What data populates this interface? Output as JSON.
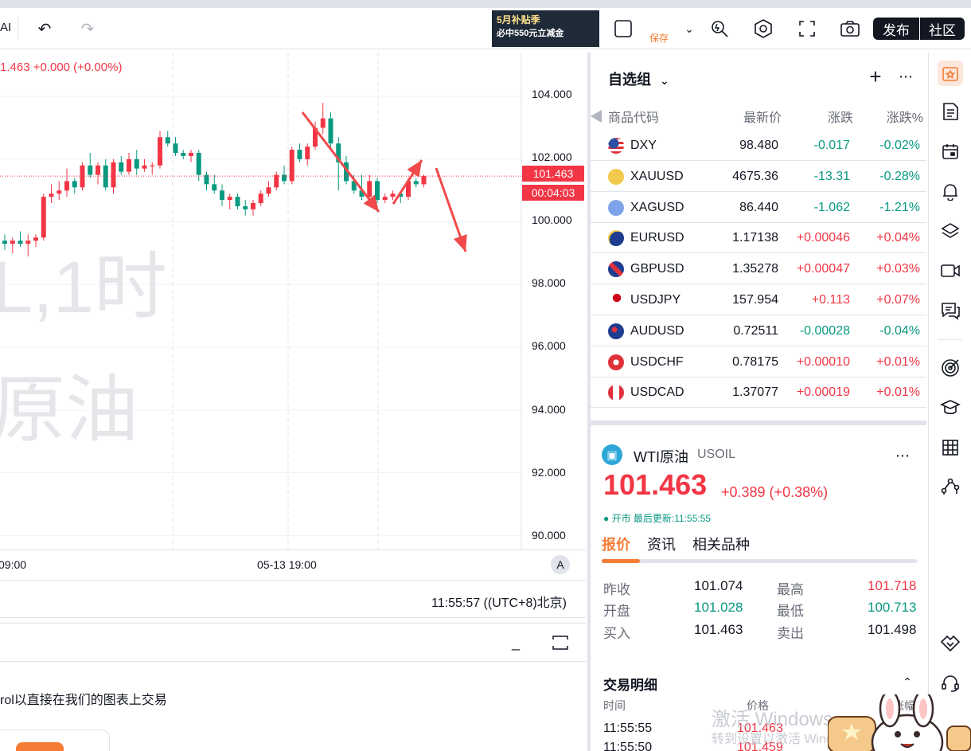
{
  "topbar": {
    "left_label": "AI",
    "promo_line1": "5月补贴季",
    "promo_line2": "必中550元立减金",
    "save_label": "保存",
    "publish_label": "发布",
    "community_label": "社区"
  },
  "chart": {
    "ohlc_info": "1.463  +0.000 (+0.00%)",
    "watermark_line1": "L,1时",
    "watermark_line2": "原油",
    "price_axis": [
      "104.000",
      "102.000",
      "100.000",
      "98.000",
      "96.000",
      "94.000",
      "92.000",
      "90.000"
    ],
    "last_price_tag": "101.463",
    "countdown_tag": "00:04:03",
    "time_labels": [
      "09:00",
      "05-13 19:00"
    ],
    "auto_button": "A",
    "clock": "11:55:57 ((UTC+8)北京)"
  },
  "chart_data": {
    "type": "candlestick",
    "ylim": [
      89.5,
      105.4
    ],
    "candles": [
      {
        "o": 99.4,
        "h": 99.6,
        "l": 99.1,
        "c": 99.3
      },
      {
        "o": 99.3,
        "h": 99.5,
        "l": 99.0,
        "c": 99.4
      },
      {
        "o": 99.4,
        "h": 99.7,
        "l": 99.2,
        "c": 99.3
      },
      {
        "o": 99.3,
        "h": 99.6,
        "l": 98.9,
        "c": 99.4
      },
      {
        "o": 99.4,
        "h": 99.6,
        "l": 99.2,
        "c": 99.5
      },
      {
        "o": 99.5,
        "h": 100.9,
        "l": 99.4,
        "c": 100.8
      },
      {
        "o": 100.8,
        "h": 101.2,
        "l": 100.6,
        "c": 100.9
      },
      {
        "o": 100.9,
        "h": 101.3,
        "l": 100.7,
        "c": 101.0
      },
      {
        "o": 101.0,
        "h": 101.7,
        "l": 100.8,
        "c": 101.3
      },
      {
        "o": 101.3,
        "h": 101.4,
        "l": 100.9,
        "c": 101.1
      },
      {
        "o": 101.1,
        "h": 101.9,
        "l": 101.0,
        "c": 101.8
      },
      {
        "o": 101.8,
        "h": 102.2,
        "l": 101.4,
        "c": 101.5
      },
      {
        "o": 101.5,
        "h": 101.9,
        "l": 101.2,
        "c": 101.8
      },
      {
        "o": 101.8,
        "h": 102.0,
        "l": 101.0,
        "c": 101.1
      },
      {
        "o": 101.1,
        "h": 102.0,
        "l": 100.9,
        "c": 101.9
      },
      {
        "o": 101.9,
        "h": 102.1,
        "l": 101.5,
        "c": 101.6
      },
      {
        "o": 101.6,
        "h": 102.2,
        "l": 101.5,
        "c": 102.0
      },
      {
        "o": 102.0,
        "h": 102.3,
        "l": 101.5,
        "c": 101.7
      },
      {
        "o": 101.7,
        "h": 102.0,
        "l": 101.6,
        "c": 101.8
      },
      {
        "o": 101.8,
        "h": 101.9,
        "l": 101.5,
        "c": 101.8
      },
      {
        "o": 101.8,
        "h": 102.9,
        "l": 101.7,
        "c": 102.7
      },
      {
        "o": 102.7,
        "h": 102.9,
        "l": 102.4,
        "c": 102.5
      },
      {
        "o": 102.5,
        "h": 102.7,
        "l": 102.1,
        "c": 102.2
      },
      {
        "o": 102.2,
        "h": 102.3,
        "l": 102.0,
        "c": 102.1
      },
      {
        "o": 102.1,
        "h": 102.3,
        "l": 101.9,
        "c": 102.2
      },
      {
        "o": 102.2,
        "h": 102.3,
        "l": 101.3,
        "c": 101.5
      },
      {
        "o": 101.5,
        "h": 101.6,
        "l": 101.0,
        "c": 101.2
      },
      {
        "o": 101.2,
        "h": 101.5,
        "l": 100.9,
        "c": 101.0
      },
      {
        "o": 101.0,
        "h": 101.2,
        "l": 100.5,
        "c": 100.7
      },
      {
        "o": 100.7,
        "h": 100.9,
        "l": 100.4,
        "c": 100.8
      },
      {
        "o": 100.8,
        "h": 100.9,
        "l": 100.4,
        "c": 100.5
      },
      {
        "o": 100.5,
        "h": 100.7,
        "l": 100.2,
        "c": 100.4
      },
      {
        "o": 100.4,
        "h": 100.7,
        "l": 100.2,
        "c": 100.6
      },
      {
        "o": 100.6,
        "h": 101.0,
        "l": 100.5,
        "c": 100.9
      },
      {
        "o": 100.9,
        "h": 101.3,
        "l": 100.8,
        "c": 101.1
      },
      {
        "o": 101.1,
        "h": 101.6,
        "l": 101.0,
        "c": 101.5
      },
      {
        "o": 101.5,
        "h": 101.8,
        "l": 101.2,
        "c": 101.3
      },
      {
        "o": 101.3,
        "h": 102.4,
        "l": 101.2,
        "c": 102.3
      },
      {
        "o": 102.3,
        "h": 102.5,
        "l": 101.9,
        "c": 102.0
      },
      {
        "o": 102.0,
        "h": 102.5,
        "l": 101.8,
        "c": 102.4
      },
      {
        "o": 102.4,
        "h": 103.2,
        "l": 102.3,
        "c": 103.0
      },
      {
        "o": 103.0,
        "h": 103.8,
        "l": 102.8,
        "c": 103.3
      },
      {
        "o": 103.3,
        "h": 103.5,
        "l": 102.3,
        "c": 102.5
      },
      {
        "o": 102.5,
        "h": 102.7,
        "l": 101.0,
        "c": 101.9
      },
      {
        "o": 101.9,
        "h": 102.1,
        "l": 101.2,
        "c": 101.3
      },
      {
        "o": 101.3,
        "h": 101.5,
        "l": 100.9,
        "c": 101.0
      },
      {
        "o": 101.0,
        "h": 101.5,
        "l": 100.7,
        "c": 100.8
      },
      {
        "o": 100.8,
        "h": 101.5,
        "l": 100.7,
        "c": 101.3
      },
      {
        "o": 101.3,
        "h": 101.4,
        "l": 100.6,
        "c": 100.7
      },
      {
        "o": 100.7,
        "h": 100.9,
        "l": 100.6,
        "c": 100.8
      },
      {
        "o": 100.8,
        "h": 101.0,
        "l": 100.7,
        "c": 100.9
      },
      {
        "o": 100.9,
        "h": 101.0,
        "l": 100.6,
        "c": 100.8
      },
      {
        "o": 100.8,
        "h": 101.4,
        "l": 100.7,
        "c": 101.3
      },
      {
        "o": 101.3,
        "h": 101.4,
        "l": 101.1,
        "c": 101.2
      },
      {
        "o": 101.2,
        "h": 101.5,
        "l": 101.1,
        "c": 101.46
      }
    ]
  },
  "watchlist": {
    "title": "自选组",
    "columns": [
      "商品代码",
      "最新价",
      "涨跌",
      "涨跌%"
    ],
    "rows": [
      {
        "symbol": "DXY",
        "last": "98.480",
        "change": "-0.017",
        "change_pct": "-0.02%",
        "dir": "down",
        "flag": "us"
      },
      {
        "symbol": "XAUUSD",
        "last": "4675.36",
        "change": "-13.31",
        "change_pct": "-0.28%",
        "dir": "down",
        "flag": "gold"
      },
      {
        "symbol": "XAGUSD",
        "last": "86.440",
        "change": "-1.062",
        "change_pct": "-1.21%",
        "dir": "down",
        "flag": "silver"
      },
      {
        "symbol": "EURUSD",
        "last": "1.17138",
        "change": "+0.00046",
        "change_pct": "+0.04%",
        "dir": "up",
        "flag": "eu"
      },
      {
        "symbol": "GBPUSD",
        "last": "1.35278",
        "change": "+0.00047",
        "change_pct": "+0.03%",
        "dir": "up",
        "flag": "gb"
      },
      {
        "symbol": "USDJPY",
        "last": "157.954",
        "change": "+0.113",
        "change_pct": "+0.07%",
        "dir": "up",
        "flag": "jp"
      },
      {
        "symbol": "AUDUSD",
        "last": "0.72511",
        "change": "-0.00028",
        "change_pct": "-0.04%",
        "dir": "down",
        "flag": "au"
      },
      {
        "symbol": "USDCHF",
        "last": "0.78175",
        "change": "+0.00010",
        "change_pct": "+0.01%",
        "dir": "up",
        "flag": "ch"
      },
      {
        "symbol": "USDCAD",
        "last": "1.37077",
        "change": "+0.00019",
        "change_pct": "+0.01%",
        "dir": "up",
        "flag": "ca"
      }
    ]
  },
  "detail": {
    "name": "WTI原油",
    "code": "USOIL",
    "price": "101.463",
    "change": "+0.389 (+0.38%)",
    "status": "● 开市  最后更新:11:55:55",
    "tabs": [
      "报价",
      "资讯",
      "相关品种"
    ],
    "quote": {
      "prev_close_label": "昨收",
      "prev_close": "101.074",
      "high_label": "最高",
      "high": "101.718",
      "open_label": "开盘",
      "open": "101.028",
      "low_label": "最低",
      "low": "100.713",
      "bid_label": "买入",
      "bid": "101.463",
      "ask_label": "卖出",
      "ask": "101.498"
    },
    "trades_title": "交易明细",
    "trades_cols": [
      "时间",
      "价格",
      "涨幅"
    ],
    "trades": [
      {
        "time": "11:55:55",
        "price": "101.463"
      },
      {
        "time": "11:55:50",
        "price": "101.459"
      }
    ]
  },
  "bottom_panel": {
    "text": "rol以直接在我们的图表上交易"
  },
  "overlay": {
    "activate_line1": "激活 Windows",
    "activate_line2": "转到设置以激活 Windows"
  },
  "colors": {
    "up": "#f23645",
    "down": "#089981",
    "accent": "#f57c35"
  }
}
